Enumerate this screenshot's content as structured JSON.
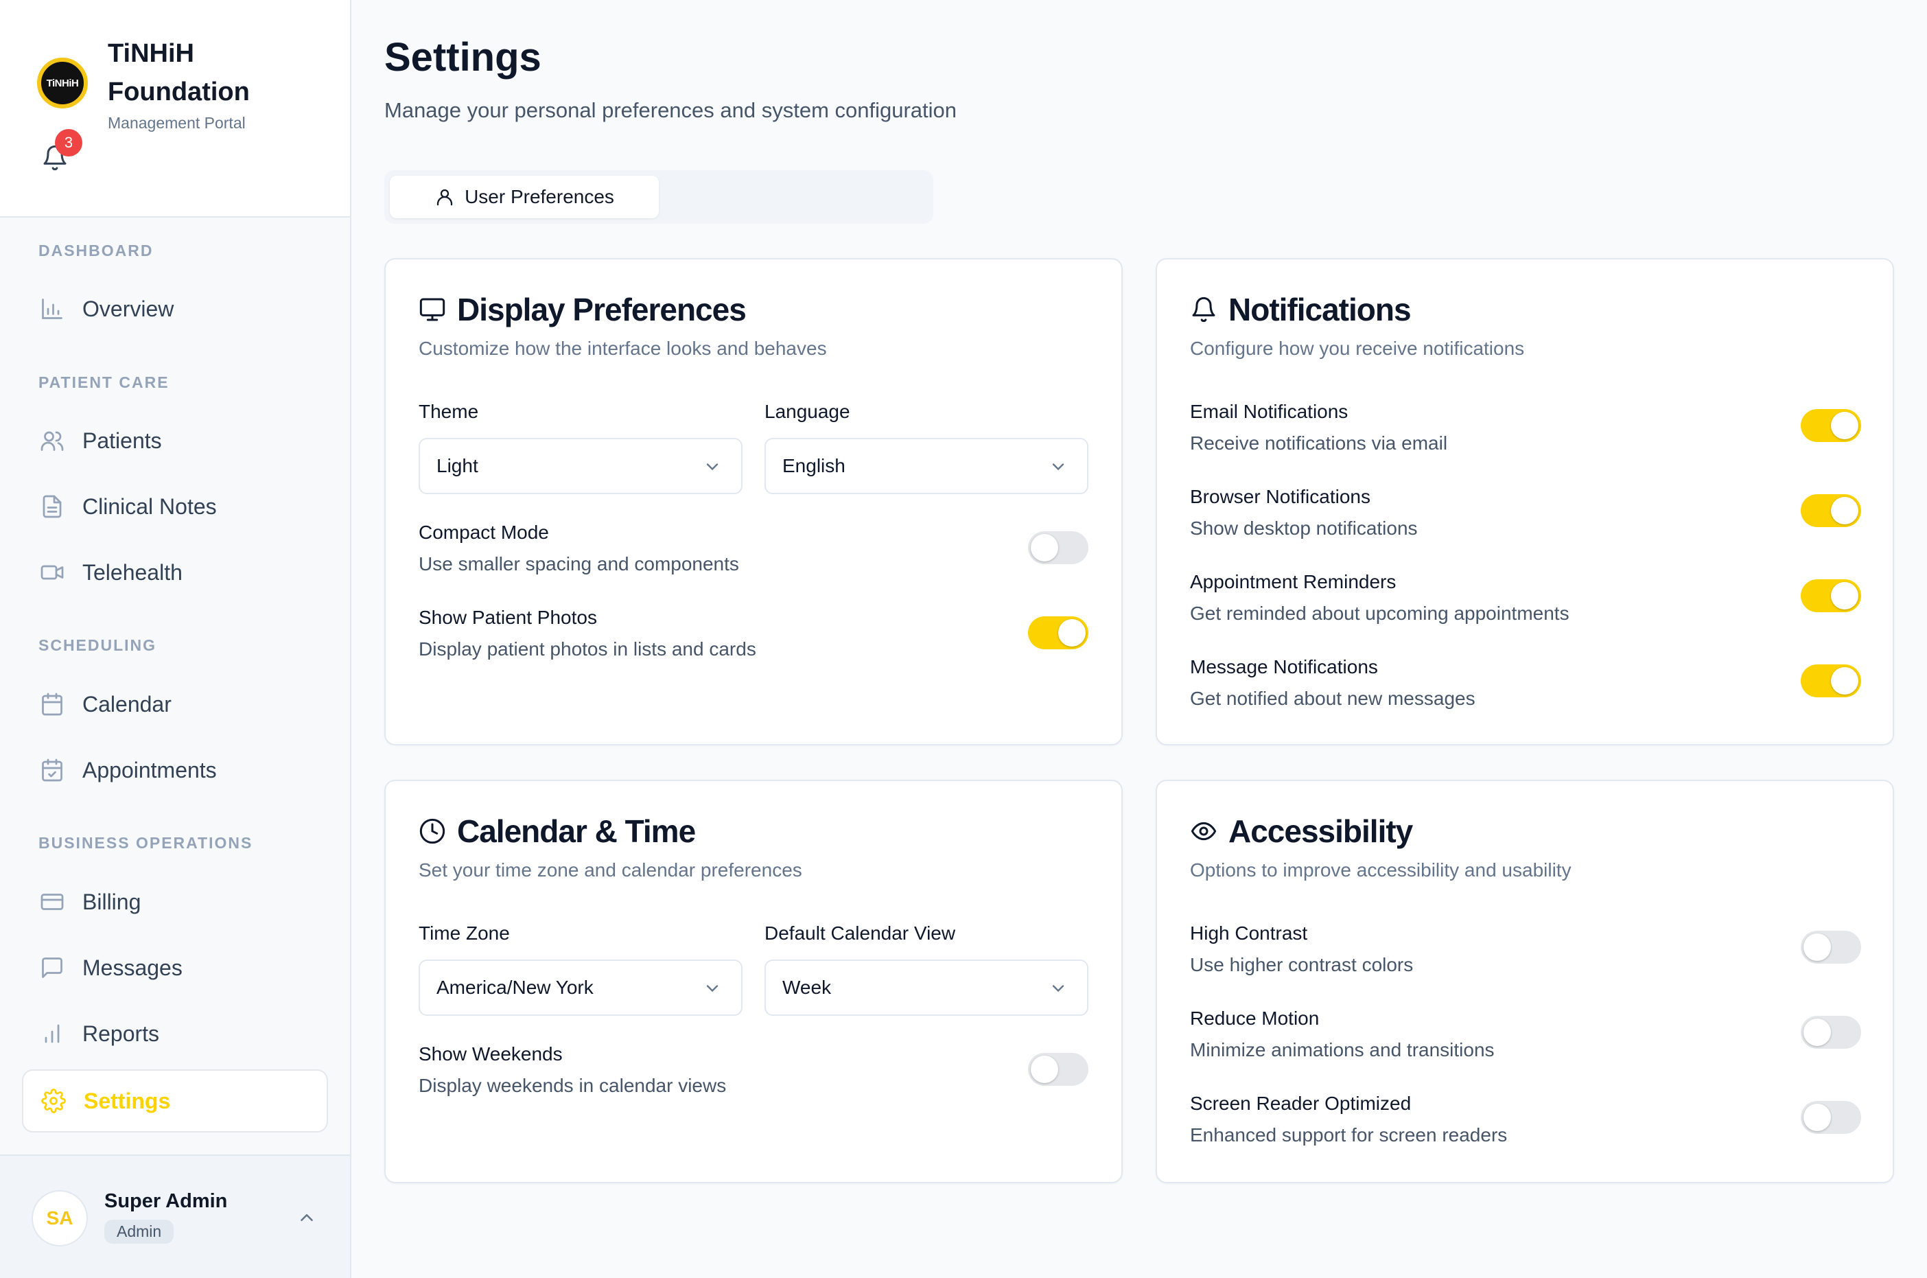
{
  "brand": {
    "org_name": "TiNHiH Foundation",
    "org_sub": "Management Portal",
    "logo_text": "TiNHiH",
    "notification_count": "3",
    "accent": "#fcd200"
  },
  "sidebar": {
    "sections": [
      {
        "label": "DASHBOARD"
      },
      {
        "label": "PATIENT CARE"
      },
      {
        "label": "SCHEDULING"
      },
      {
        "label": "BUSINESS OPERATIONS"
      }
    ],
    "items": [
      {
        "label": "Overview",
        "icon": "bar-chart-icon"
      },
      {
        "label": "Patients",
        "icon": "users-icon"
      },
      {
        "label": "Clinical Notes",
        "icon": "document-icon"
      },
      {
        "label": "Telehealth",
        "icon": "video-icon"
      },
      {
        "label": "Calendar",
        "icon": "calendar-icon"
      },
      {
        "label": "Appointments",
        "icon": "calendar-check-icon"
      },
      {
        "label": "Billing",
        "icon": "credit-card-icon"
      },
      {
        "label": "Messages",
        "icon": "message-icon"
      },
      {
        "label": "Reports",
        "icon": "bar-chart-icon"
      },
      {
        "label": "Settings",
        "icon": "gear-icon",
        "active": true
      }
    ]
  },
  "user": {
    "initials": "SA",
    "name": "Super Admin",
    "role": "Admin"
  },
  "page": {
    "title": "Settings",
    "subtitle": "Manage your personal preferences and system configuration"
  },
  "tabs": [
    {
      "label": "User Preferences",
      "active": true
    }
  ],
  "display": {
    "title": "Display Preferences",
    "description": "Customize how the interface looks and behaves",
    "theme_label": "Theme",
    "theme_value": "Light",
    "language_label": "Language",
    "language_value": "English",
    "toggles": [
      {
        "title": "Compact Mode",
        "desc": "Use smaller spacing and components",
        "on": false
      },
      {
        "title": "Show Patient Photos",
        "desc": "Display patient photos in lists and cards",
        "on": true
      }
    ]
  },
  "notifications": {
    "title": "Notifications",
    "description": "Configure how you receive notifications",
    "toggles": [
      {
        "title": "Email Notifications",
        "desc": "Receive notifications via email",
        "on": true
      },
      {
        "title": "Browser Notifications",
        "desc": "Show desktop notifications",
        "on": true
      },
      {
        "title": "Appointment Reminders",
        "desc": "Get reminded about upcoming appointments",
        "on": true
      },
      {
        "title": "Message Notifications",
        "desc": "Get notified about new messages",
        "on": true
      }
    ]
  },
  "calendar": {
    "title": "Calendar & Time",
    "description": "Set your time zone and calendar preferences",
    "timezone_label": "Time Zone",
    "timezone_value": "America/New York",
    "view_label": "Default Calendar View",
    "view_value": "Week",
    "toggles": [
      {
        "title": "Show Weekends",
        "desc": "Display weekends in calendar views",
        "on": false
      }
    ]
  },
  "accessibility": {
    "title": "Accessibility",
    "description": "Options to improve accessibility and usability",
    "toggles": [
      {
        "title": "High Contrast",
        "desc": "Use higher contrast colors",
        "on": false
      },
      {
        "title": "Reduce Motion",
        "desc": "Minimize animations and transitions",
        "on": false
      },
      {
        "title": "Screen Reader Optimized",
        "desc": "Enhanced support for screen readers",
        "on": false
      }
    ]
  }
}
